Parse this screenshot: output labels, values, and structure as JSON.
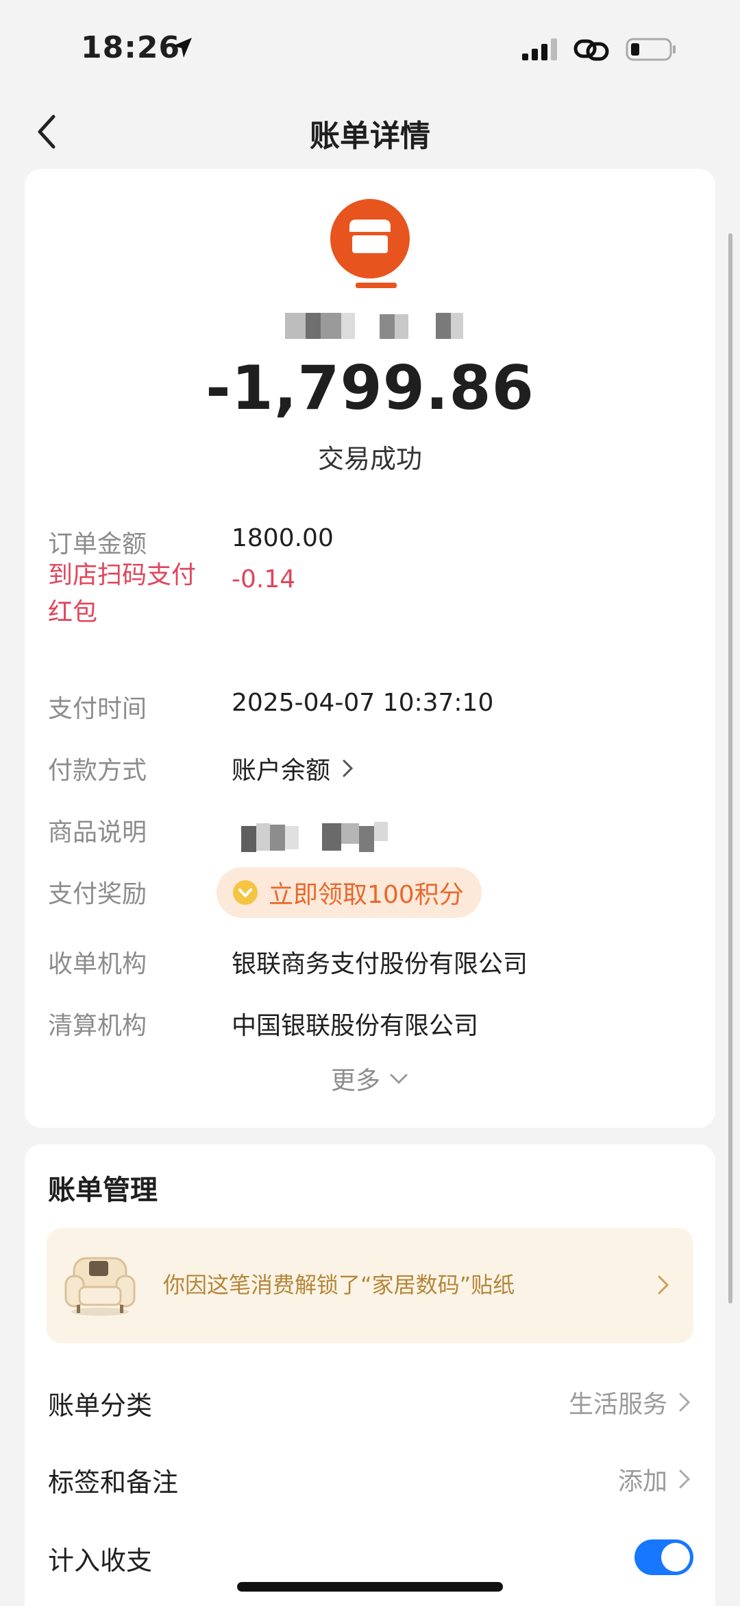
{
  "status_bar": {
    "time": "18:26"
  },
  "nav": {
    "title": "账单详情"
  },
  "detail": {
    "amount": "-1,799.86",
    "status": "交易成功",
    "rows": {
      "order_amount": {
        "label": "订单金额",
        "value": "1800.00"
      },
      "coupon": {
        "label_line1": "到店扫码支付",
        "label_line2": "红包",
        "value": "-0.14"
      },
      "pay_time": {
        "label": "支付时间",
        "value": "2025-04-07 10:37:10"
      },
      "pay_method": {
        "label": "付款方式",
        "value": "账户余额"
      },
      "goods_desc": {
        "label": "商品说明"
      },
      "reward": {
        "label": "支付奖励",
        "value": "立即领取100积分"
      },
      "acquirer": {
        "label": "收单机构",
        "value": "银联商务支付股份有限公司"
      },
      "clearing": {
        "label": "清算机构",
        "value": "中国银联股份有限公司"
      }
    },
    "more_label": "更多"
  },
  "manage": {
    "title": "账单管理",
    "sticker_banner": "你因这笔消费解锁了“家居数码”贴纸",
    "category": {
      "label": "账单分类",
      "value": "生活服务"
    },
    "tags": {
      "label": "标签和备注",
      "value": "添加"
    },
    "include": {
      "label": "计入收支",
      "enabled": true
    }
  },
  "colors": {
    "accent_blue": "#1777ff",
    "merchant_orange": "#e8541e",
    "warning_red": "#e0455a",
    "reward_orange": "#e8692a",
    "sticker_gold": "#b5853a"
  },
  "icons": [
    "location-arrow-icon",
    "signal-icon",
    "link-icon",
    "battery-icon",
    "back-chevron-icon",
    "merchant-store-icon",
    "chevron-right-icon",
    "coin-icon",
    "chevron-down-icon",
    "sofa-sticker-icon"
  ]
}
